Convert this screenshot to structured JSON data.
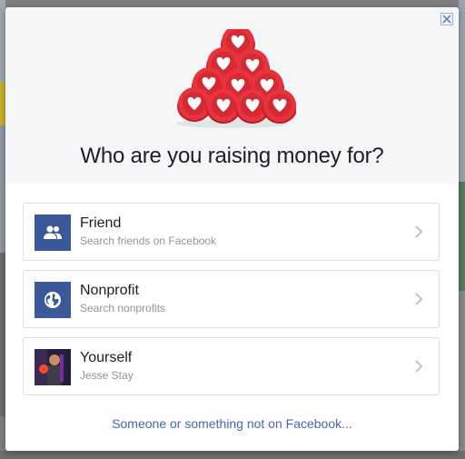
{
  "dialog": {
    "title": "Who are you raising money for?",
    "close_icon": "close-icon"
  },
  "options": [
    {
      "title": "Friend",
      "subtitle": "Search friends on Facebook",
      "icon": "friends-icon"
    },
    {
      "title": "Nonprofit",
      "subtitle": "Search nonprofits",
      "icon": "globe-icon"
    },
    {
      "title": "Yourself",
      "subtitle": "Jesse Stay",
      "icon": "avatar"
    }
  ],
  "footer": {
    "link": "Someone or something not on Facebook..."
  },
  "colors": {
    "brand": "#3b5998",
    "link": "#4267b2",
    "heart_red": "#e8333c"
  }
}
